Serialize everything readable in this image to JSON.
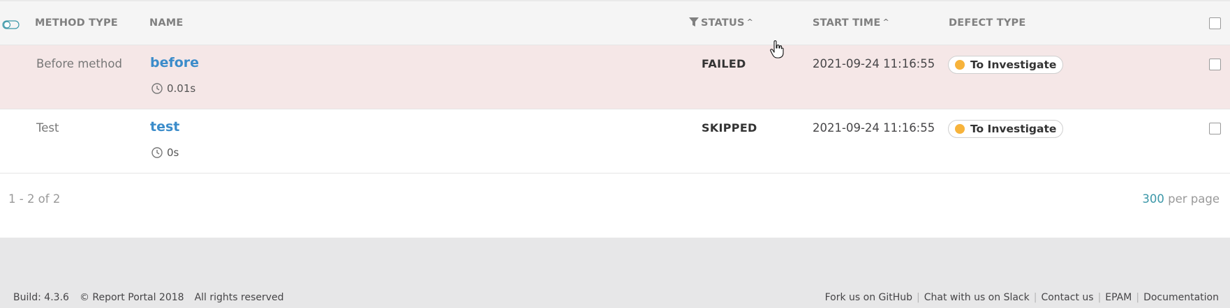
{
  "columns": {
    "method_type": "METHOD TYPE",
    "name": "NAME",
    "status": "STATUS",
    "start_time": "START TIME",
    "defect_type": "DEFECT TYPE",
    "sort_caret": "^"
  },
  "rows": [
    {
      "method_type": "Before method",
      "name": "before",
      "duration": "0.01s",
      "status": "FAILED",
      "start_time": "2021-09-24 11:16:55",
      "defect_type": "To Investigate"
    },
    {
      "method_type": "Test",
      "name": "test",
      "duration": "0s",
      "status": "SKIPPED",
      "start_time": "2021-09-24 11:16:55",
      "defect_type": "To Investigate"
    }
  ],
  "colors": {
    "failed_row_bg": "#f5e7e7",
    "link": "#3b8cca",
    "defect_to_investigate": "#f7b33b",
    "accent": "#3b97a8"
  },
  "pagination": {
    "range": "1 - 2 of 2",
    "per_page_value": "300",
    "per_page_label": "per page"
  },
  "footer": {
    "build": "Build: 4.3.6",
    "copyright": "© Report Portal 2018",
    "rights": "All rights reserved",
    "links": [
      "Fork us on GitHub",
      "Chat with us on Slack",
      "Contact us",
      "EPAM",
      "Documentation"
    ],
    "separator": "|"
  },
  "icons": {
    "toggle": "toggle-icon",
    "filter": "filter-icon",
    "clock": "clock-icon",
    "cursor": "hand-pointer-icon"
  }
}
